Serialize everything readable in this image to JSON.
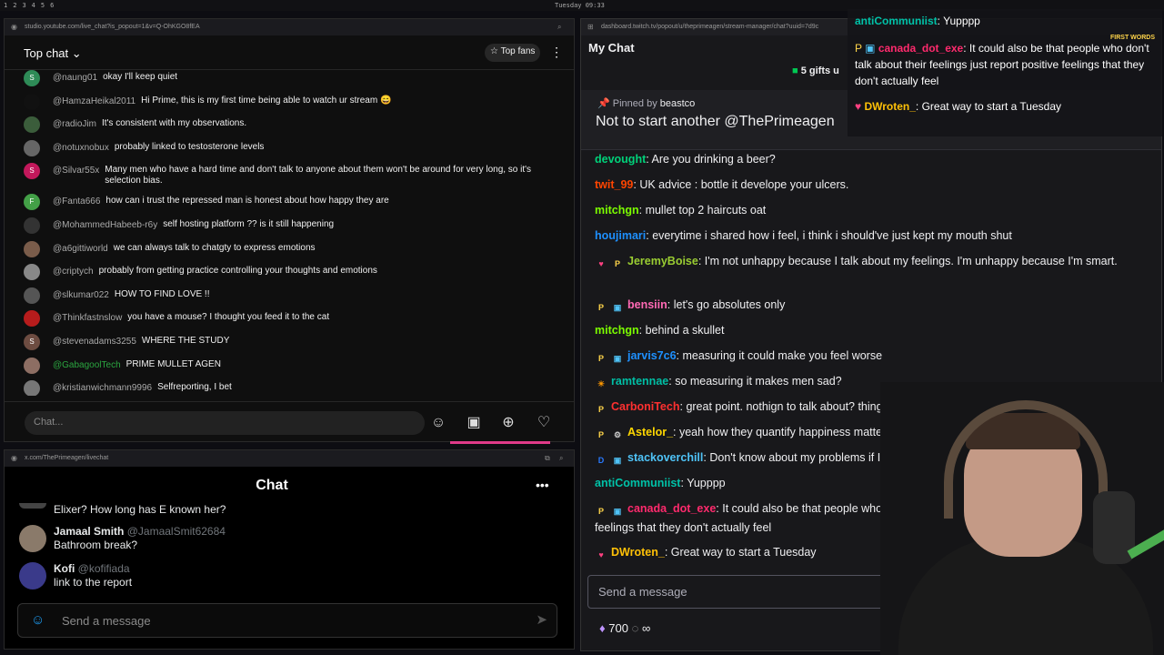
{
  "topbar": {
    "workspaces": [
      "1",
      "2",
      "3",
      "4",
      "5",
      "6"
    ],
    "clock": "Tuesday 09:33"
  },
  "youtube": {
    "url": "studio.youtube.com/live_chat?is_popout=1&v=Q-OhKGO8fEA",
    "title": "Top chat",
    "top_fans": "Top fans",
    "input_placeholder": "Chat...",
    "messages": [
      {
        "author": "@naung01",
        "text": "okay I'll keep quiet",
        "avatar": "S",
        "color": "#2e8b57"
      },
      {
        "author": "@HamzaHeikal2011",
        "text": "Hi Prime, this is my first time being able to watch ur stream 😄",
        "avatar": "",
        "color": "#111"
      },
      {
        "author": "@radioJim",
        "text": "It's consistent with my observations.",
        "avatar": "",
        "color": "#3b5d3b"
      },
      {
        "author": "@notuxnobux",
        "text": "probably linked to testosterone levels",
        "avatar": "",
        "color": "#666"
      },
      {
        "author": "@Silvar55x",
        "text": "Many men who have a hard time and don't talk to anyone about them won't be around for very long, so it's selection bias.",
        "avatar": "S",
        "color": "#c2185b"
      },
      {
        "author": "@Fanta666",
        "text": "how can i trust the repressed man is honest about how happy they are",
        "avatar": "F",
        "color": "#43a047"
      },
      {
        "author": "@MohammedHabeeb-r6y",
        "text": "self hosting platform ?? is it still happening",
        "avatar": "",
        "color": "#333"
      },
      {
        "author": "@a6gittiworld",
        "text": "we can always talk to chatgty to express emotions",
        "avatar": "",
        "color": "#7a5c4a"
      },
      {
        "author": "@criptych",
        "text": "probably from getting practice controlling your thoughts and emotions",
        "avatar": "",
        "color": "#888"
      },
      {
        "author": "@slkumar022",
        "text": "HOW TO FIND LOVE !!",
        "avatar": "",
        "color": "#555"
      },
      {
        "author": "@Thinkfastnslow",
        "text": "you have a mouse? I thought you feed it to the cat",
        "avatar": "",
        "color": "#b71c1c"
      },
      {
        "author": "@stevenadams3255",
        "text": "WHERE THE STUDY",
        "avatar": "S",
        "color": "#6d4c41"
      },
      {
        "author": "@GabagoolTech",
        "text": "PRIME MULLET AGEN",
        "avatar": "",
        "color": "#8d6e63",
        "highlight": true
      },
      {
        "author": "@kristianwichmann9996",
        "text": "Selfreporting, I bet",
        "avatar": "",
        "color": "#777"
      }
    ]
  },
  "x": {
    "url": "x.com/ThePrimeagen/livechat",
    "title": "Chat",
    "input_placeholder": "Send a message",
    "posts": [
      {
        "name": "",
        "handle": "",
        "text": "Elixer? How long has E known her?"
      },
      {
        "name": "Jamaal Smith",
        "handle": "@JamaalSmit62684",
        "text": "Bathroom break?"
      },
      {
        "name": "Kofi",
        "handle": "@kofifiada",
        "text": "link to the report"
      }
    ]
  },
  "twitch": {
    "url": "dashboard.twitch.tv/popout/u/theprimeagen/stream-manager/chat?uuid=7d9c",
    "title": "My Chat",
    "gifts": "5 gifts u",
    "pinned_by_label": "Pinned by",
    "pinned_by_user": "beastco",
    "pinned_text": "Not to start another @ThePrimeagen",
    "input_placeholder": "Send a message",
    "points": "700",
    "infinity": "∞",
    "messages": [
      {
        "user": "devought",
        "color": "#00d27a",
        "text": "Are you drinking a beer?",
        "badges": []
      },
      {
        "user": "twit_99",
        "color": "#ff4500",
        "text": "UK advice : bottle it develope your ulcers.",
        "badges": []
      },
      {
        "user": "mitchgn",
        "color": "#7cfc00",
        "text": "mullet top 2 haircuts oat",
        "badges": []
      },
      {
        "user": "houjimari",
        "color": "#1e90ff",
        "text": "everytime i shared how i feel, i think i should've just kept my mouth shut",
        "badges": []
      },
      {
        "user": "JeremyBoise",
        "color": "#9acd32",
        "text": "I'm not unhappy because I talk about my feelings. I'm unhappy because I'm smart.",
        "badges": [
          "♥",
          "P"
        ]
      },
      {
        "user": "bensiin",
        "color": "#ff69b4",
        "text": "let's go absolutes only",
        "badges": [
          "P",
          "▣"
        ]
      },
      {
        "user": "mitchgn",
        "color": "#7cfc00",
        "text": "behind a skullet",
        "badges": []
      },
      {
        "user": "jarvis7c6",
        "color": "#1e90ff",
        "text": "measuring it could make you feel worse",
        "badges": [
          "P",
          "▣"
        ]
      },
      {
        "user": "ramtennae",
        "color": "#00bfa5",
        "text": "so measuring it makes men sad?",
        "badges": [
          "☀"
        ]
      },
      {
        "user": "CarboniTech",
        "color": "#ff3030",
        "text": "great point. nothign to talk about? things might be",
        "badges": [
          "P"
        ]
      },
      {
        "user": "Astelor_",
        "color": "#ffd700",
        "text": "yeah how they quantify happiness matters",
        "badges": [
          "P",
          "⚙"
        ]
      },
      {
        "user": "stackoverchill",
        "color": "#4fc3f7",
        "text": "Don't know about my problems if I don't",
        "badges": [
          "D",
          "▣"
        ]
      },
      {
        "user": "antiCommuniist",
        "color": "#00c2a8",
        "text": "Yupppp",
        "badges": []
      },
      {
        "user": "canada_dot_exe",
        "color": "#ff2a6d",
        "text": "It could also be that people who don't talk about their feelings just report positive feelings that they don't actually feel",
        "badges": [
          "P",
          "▣"
        ]
      },
      {
        "user": "DWroten_",
        "color": "#ffc107",
        "text": "Great way to start a Tuesday",
        "badges": [
          "♥"
        ]
      }
    ]
  },
  "overlay": {
    "first_words": "FIRST WORDS",
    "messages": [
      {
        "user": "antiCommuniist",
        "color": "#00c2a8",
        "text": "Yupppp"
      },
      {
        "user": "canada_dot_exe",
        "color": "#ff2a6d",
        "text": "It could also be that people who don't talk about their feelings just report positive feelings that they don't actually feel"
      },
      {
        "user": "DWroten_",
        "color": "#ffc107",
        "text": "Great way to start a Tuesday"
      }
    ]
  }
}
